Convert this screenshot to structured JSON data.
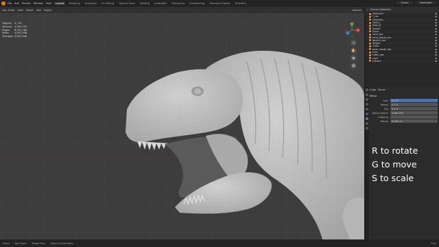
{
  "menubar": {
    "menus": [
      "File",
      "Edit",
      "Render",
      "Window",
      "Help"
    ],
    "workspaces": [
      "Layout",
      "Modeling",
      "Sculpting",
      "UV Editing",
      "Texture Paint",
      "Shading",
      "Animation",
      "Rendering",
      "Compositing",
      "Geometry Nodes",
      "Scripting"
    ],
    "active_workspace": "Layout",
    "scene": "Scene",
    "view_layer": "ViewLayer"
  },
  "viewport": {
    "header": [
      "Obj. Mode",
      "View",
      "Select",
      "Add",
      "Object"
    ],
    "stats": [
      {
        "k": "Objects",
        "v": "1 / 16"
      },
      {
        "k": "Vertices",
        "v": "2,903,705"
      },
      {
        "k": "Edges",
        "v": "8,591,766"
      },
      {
        "k": "Faces",
        "v": "5,807,938"
      },
      {
        "k": "Triangles",
        "v": "5,807,938"
      }
    ],
    "options": "Options"
  },
  "outliner": {
    "title": "Scene Collection",
    "items": [
      "Collection",
      "T_rex",
      "Collection",
      "Tooth_L",
      "Tooth_R",
      "Eyeball",
      "Gums",
      "Inner_Jaw",
      "Inner_Mouth_low",
      "Nostrils_low",
      "Tongue",
      "Claws",
      "Inner_mouth_low",
      "Eyes",
      "Lower_Jaw",
      "Light",
      "Camera"
    ]
  },
  "properties": {
    "object": "Cube",
    "modifier": "Mirror",
    "panel": "Mirror",
    "fields": [
      {
        "label": "Axis",
        "value": "X Y Z"
      },
      {
        "label": "Bisect",
        "value": "X Y Z"
      },
      {
        "label": "Flip",
        "value": "X Y Z"
      },
      {
        "label": "Mirror Object",
        "value": "Cube.001"
      },
      {
        "label": "Clipping",
        "value": ""
      },
      {
        "label": "Merge",
        "value": "0.001 m"
      }
    ]
  },
  "overlay": {
    "line1": "R to rotate",
    "line2": "G to move",
    "line3": "S to scale"
  },
  "statusbar": {
    "items": [
      "Select",
      "Box Select",
      "Rotate View",
      "Object Context Menu"
    ],
    "version": "3.6.0"
  },
  "colors": {
    "viewport_bg": "#3d3d3d",
    "model": "#c9c9c9",
    "accent": "#e87d0d"
  }
}
